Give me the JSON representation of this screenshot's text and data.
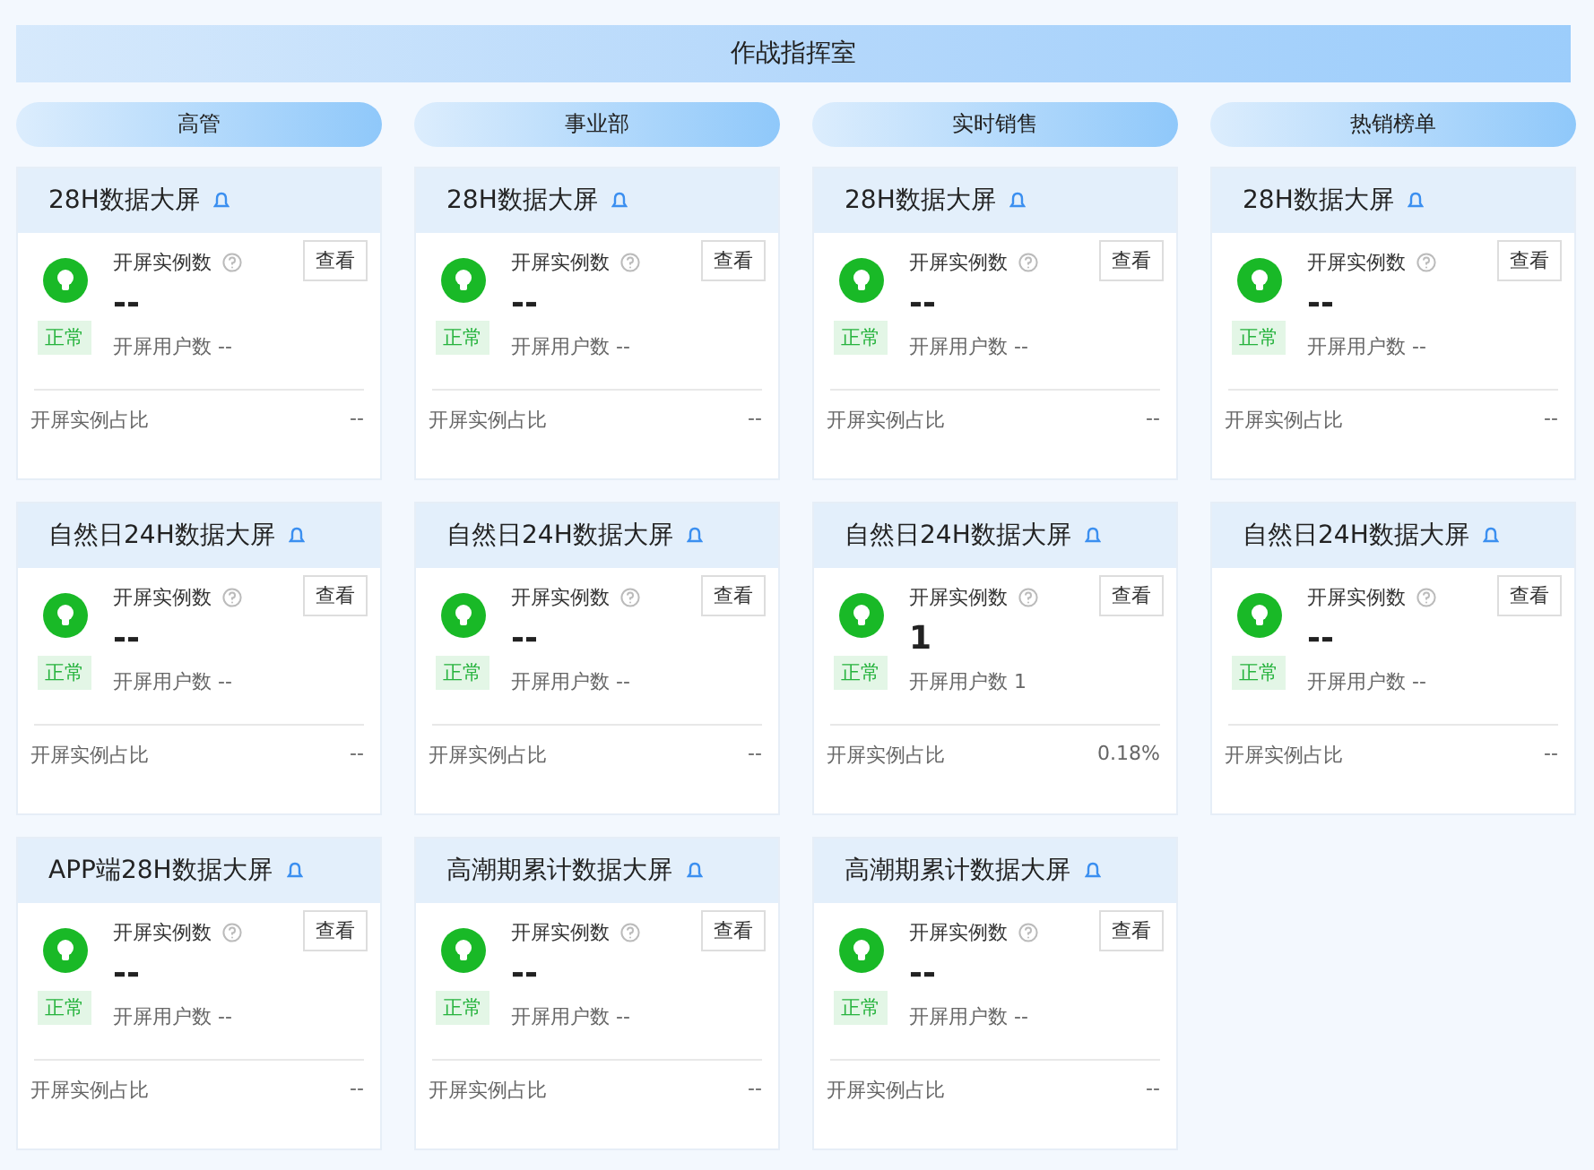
{
  "title": "作战指挥室",
  "columns": [
    {
      "label": "高管",
      "cards": [
        {
          "title": "28H数据大屏",
          "status": "正常",
          "metric_label": "开屏实例数",
          "value": "--",
          "users": "开屏用户数 --",
          "ratio_label": "开屏实例占比",
          "ratio": "--",
          "button": "查看"
        },
        {
          "title": "自然日24H数据大屏",
          "status": "正常",
          "metric_label": "开屏实例数",
          "value": "--",
          "users": "开屏用户数 --",
          "ratio_label": "开屏实例占比",
          "ratio": "--",
          "button": "查看"
        },
        {
          "title": "APP端28H数据大屏",
          "status": "正常",
          "metric_label": "开屏实例数",
          "value": "--",
          "users": "开屏用户数 --",
          "ratio_label": "开屏实例占比",
          "ratio": "--",
          "button": "查看"
        }
      ]
    },
    {
      "label": "事业部",
      "cards": [
        {
          "title": "28H数据大屏",
          "status": "正常",
          "metric_label": "开屏实例数",
          "value": "--",
          "users": "开屏用户数 --",
          "ratio_label": "开屏实例占比",
          "ratio": "--",
          "button": "查看"
        },
        {
          "title": "自然日24H数据大屏",
          "status": "正常",
          "metric_label": "开屏实例数",
          "value": "--",
          "users": "开屏用户数 --",
          "ratio_label": "开屏实例占比",
          "ratio": "--",
          "button": "查看"
        },
        {
          "title": "高潮期累计数据大屏",
          "status": "正常",
          "metric_label": "开屏实例数",
          "value": "--",
          "users": "开屏用户数 --",
          "ratio_label": "开屏实例占比",
          "ratio": "--",
          "button": "查看"
        }
      ]
    },
    {
      "label": "实时销售",
      "cards": [
        {
          "title": "28H数据大屏",
          "status": "正常",
          "metric_label": "开屏实例数",
          "value": "--",
          "users": "开屏用户数 --",
          "ratio_label": "开屏实例占比",
          "ratio": "--",
          "button": "查看"
        },
        {
          "title": "自然日24H数据大屏",
          "status": "正常",
          "metric_label": "开屏实例数",
          "value": "1",
          "users": "开屏用户数 1",
          "ratio_label": "开屏实例占比",
          "ratio": "0.18%",
          "button": "查看"
        },
        {
          "title": "高潮期累计数据大屏",
          "status": "正常",
          "metric_label": "开屏实例数",
          "value": "--",
          "users": "开屏用户数 --",
          "ratio_label": "开屏实例占比",
          "ratio": "--",
          "button": "查看"
        }
      ]
    },
    {
      "label": "热销榜单",
      "cards": [
        {
          "title": "28H数据大屏",
          "status": "正常",
          "metric_label": "开屏实例数",
          "value": "--",
          "users": "开屏用户数 --",
          "ratio_label": "开屏实例占比",
          "ratio": "--",
          "button": "查看"
        },
        {
          "title": "自然日24H数据大屏",
          "status": "正常",
          "metric_label": "开屏实例数",
          "value": "--",
          "users": "开屏用户数 --",
          "ratio_label": "开屏实例占比",
          "ratio": "--",
          "button": "查看"
        }
      ]
    }
  ]
}
